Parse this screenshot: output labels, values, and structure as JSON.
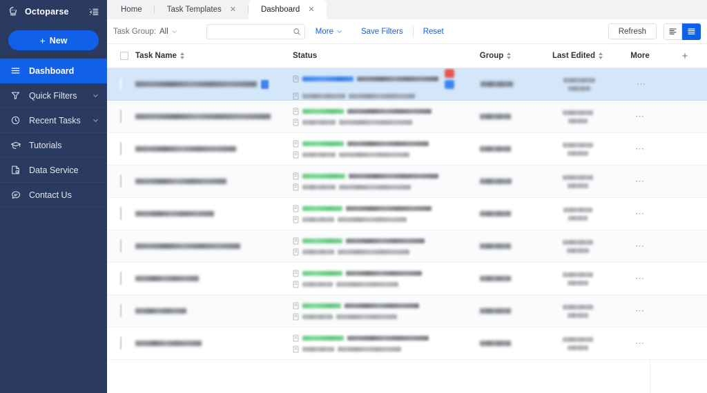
{
  "sidebar": {
    "brand": "Octoparse",
    "logo_icon": "octopus-logo-icon",
    "collapse_icon": "sidebar-collapse-icon",
    "new_button": {
      "label": "New",
      "plus": "+"
    },
    "items": [
      {
        "label": "Dashboard",
        "icon": "menu-lines-icon",
        "active": true,
        "caret": false
      },
      {
        "label": "Quick Filters",
        "icon": "funnel-filter-icon",
        "active": false,
        "caret": true
      },
      {
        "label": "Recent Tasks",
        "icon": "clock-history-icon",
        "active": false,
        "caret": true
      },
      {
        "label": "Tutorials",
        "icon": "graduation-cap-icon",
        "active": false,
        "caret": false
      },
      {
        "label": "Data Service",
        "icon": "data-document-icon",
        "active": false,
        "caret": false
      },
      {
        "label": "Contact Us",
        "icon": "chat-bubble-icon",
        "active": false,
        "caret": false
      }
    ]
  },
  "tabs": [
    {
      "label": "Home",
      "active": false,
      "closable": false
    },
    {
      "label": "Task Templates",
      "active": false,
      "closable": true
    },
    {
      "label": "Dashboard",
      "active": true,
      "closable": true
    }
  ],
  "toolbar": {
    "task_group_label": "Task Group:",
    "task_group_value": "All",
    "search_placeholder": "",
    "search_value": "",
    "search_icon": "search-icon",
    "more_label": "More",
    "save_filters_label": "Save Filters",
    "reset_label": "Reset",
    "refresh_label": "Refresh",
    "view_compact_icon": "list-compact-view-icon",
    "view_detail_icon": "list-detail-view-icon",
    "active_view": "detail",
    "accent_color": "#1160e8"
  },
  "table": {
    "columns": [
      {
        "key": "checkbox",
        "label": "",
        "sortable": false
      },
      {
        "key": "task_name",
        "label": "Task Name",
        "sortable": true
      },
      {
        "key": "status",
        "label": "Status",
        "sortable": false
      },
      {
        "key": "group",
        "label": "Group",
        "sortable": true
      },
      {
        "key": "last_edited",
        "label": "Last Edited",
        "sortable": true
      },
      {
        "key": "more",
        "label": "More",
        "sortable": false
      },
      {
        "key": "add_column",
        "label": "+",
        "sortable": false
      }
    ],
    "rows": [
      {
        "selected": true,
        "name_redacted": true,
        "name_width": 176,
        "has_name_badge": true,
        "status_color": "blue",
        "status_w1": 74,
        "status_w2": 62,
        "detail_w1": 118,
        "detail_w2": 96,
        "has_action_buttons": true,
        "group_w": 47,
        "edited_w1": 46,
        "edited_w2": 32,
        "more_glyph": "⋯"
      },
      {
        "selected": false,
        "name_redacted": true,
        "name_width": 196,
        "has_name_badge": false,
        "status_color": "green",
        "status_w1": 60,
        "status_w2": 48,
        "detail_w1": 122,
        "detail_w2": 106,
        "has_action_buttons": false,
        "group_w": 45,
        "edited_w1": 44,
        "edited_w2": 28,
        "more_glyph": "⋯"
      },
      {
        "selected": false,
        "name_redacted": true,
        "name_width": 146,
        "has_name_badge": false,
        "status_color": "green",
        "status_w1": 60,
        "status_w2": 48,
        "detail_w1": 118,
        "detail_w2": 102,
        "has_action_buttons": false,
        "group_w": 45,
        "edited_w1": 44,
        "edited_w2": 30,
        "more_glyph": "⋯"
      },
      {
        "selected": false,
        "name_redacted": true,
        "name_width": 132,
        "has_name_badge": false,
        "status_color": "green",
        "status_w1": 62,
        "status_w2": 48,
        "detail_w1": 130,
        "detail_w2": 104,
        "has_action_buttons": false,
        "group_w": 46,
        "edited_w1": 44,
        "edited_w2": 30,
        "more_glyph": "⋯"
      },
      {
        "selected": false,
        "name_redacted": true,
        "name_width": 114,
        "has_name_badge": false,
        "status_color": "green",
        "status_w1": 58,
        "status_w2": 46,
        "detail_w1": 124,
        "detail_w2": 100,
        "has_action_buttons": false,
        "group_w": 45,
        "edited_w1": 42,
        "edited_w2": 28,
        "more_glyph": "⋯"
      },
      {
        "selected": false,
        "name_redacted": true,
        "name_width": 152,
        "has_name_badge": false,
        "status_color": "green",
        "status_w1": 58,
        "status_w2": 46,
        "detail_w1": 114,
        "detail_w2": 104,
        "has_action_buttons": false,
        "group_w": 45,
        "edited_w1": 44,
        "edited_w2": 32,
        "more_glyph": "⋯"
      },
      {
        "selected": false,
        "name_redacted": true,
        "name_width": 92,
        "has_name_badge": false,
        "status_color": "green",
        "status_w1": 58,
        "status_w2": 44,
        "detail_w1": 110,
        "detail_w2": 90,
        "has_action_buttons": false,
        "group_w": 45,
        "edited_w1": 44,
        "edited_w2": 30,
        "more_glyph": "⋯"
      },
      {
        "selected": false,
        "name_redacted": true,
        "name_width": 74,
        "has_name_badge": false,
        "status_color": "green",
        "status_w1": 56,
        "status_w2": 44,
        "detail_w1": 108,
        "detail_w2": 88,
        "has_action_buttons": false,
        "group_w": 45,
        "edited_w1": 44,
        "edited_w2": 30,
        "more_glyph": "⋯"
      },
      {
        "selected": false,
        "name_redacted": true,
        "name_width": 96,
        "has_name_badge": false,
        "status_color": "green",
        "status_w1": 60,
        "status_w2": 46,
        "detail_w1": 118,
        "detail_w2": 92,
        "has_action_buttons": false,
        "group_w": 45,
        "edited_w1": 44,
        "edited_w2": 30,
        "more_glyph": "⋯"
      }
    ]
  }
}
